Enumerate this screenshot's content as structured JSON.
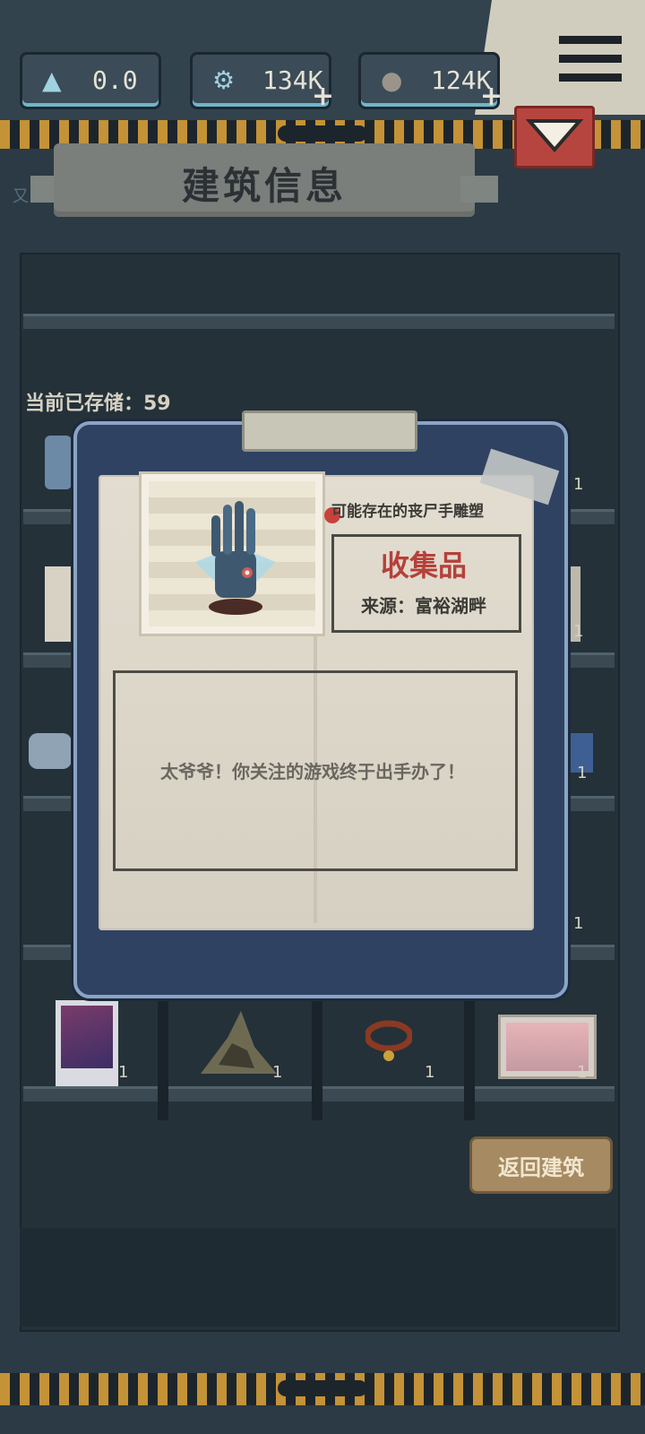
{
  "resources": [
    {
      "icon": "crystal-icon",
      "value": "0.0",
      "has_plus": false
    },
    {
      "icon": "parts-icon",
      "value": "134K",
      "has_plus": true
    },
    {
      "icon": "ore-icon",
      "value": "124K",
      "has_plus": true
    }
  ],
  "header": {
    "title": "建筑信息",
    "left_hint": "又"
  },
  "storage": {
    "label": "当前已存储：59"
  },
  "shelf_counts": [
    "1",
    "1",
    "1",
    "1",
    "1",
    "1",
    "1",
    "1"
  ],
  "item_detail": {
    "name": "可能存在的丧尸手雕塑",
    "category": "收集品",
    "source": "来源：富裕湖畔",
    "description": "太爷爷！你关注的游戏终于出手办了！"
  },
  "buttons": {
    "return": "返回建筑"
  },
  "colors": {
    "accent_red": "#b6403a",
    "stripe_gold": "#c49237",
    "modal_blue": "#2f4262"
  }
}
